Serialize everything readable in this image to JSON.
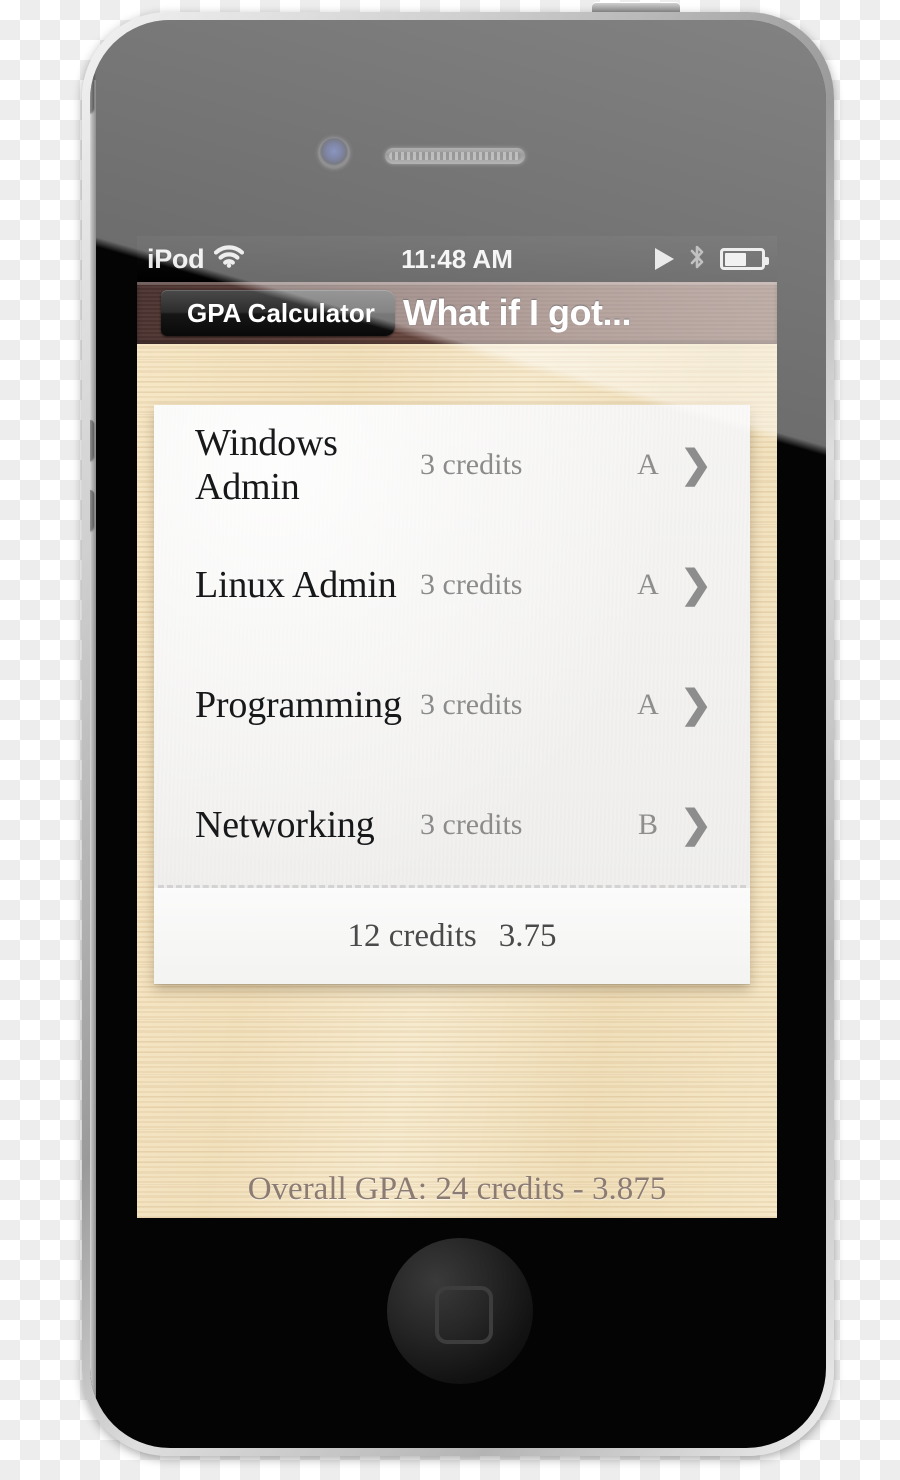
{
  "status_bar": {
    "carrier": "iPod",
    "wifi_icon": "wifi-icon",
    "time": "11:48 AM",
    "play_icon": "play-icon",
    "bluetooth_icon": "bluetooth-icon",
    "battery_icon": "battery-icon",
    "battery_level_percent": 60
  },
  "nav_bar": {
    "back_label": "GPA Calculator",
    "title": "What if I got..."
  },
  "course_list": {
    "rows": [
      {
        "name": "Windows Admin",
        "credits": "3 credits",
        "grade": "A",
        "chevron": "chevron-right-icon"
      },
      {
        "name": "Linux Admin",
        "credits": "3 credits",
        "grade": "A",
        "chevron": "chevron-right-icon"
      },
      {
        "name": "Programming",
        "credits": "3 credits",
        "grade": "A",
        "chevron": "chevron-right-icon"
      },
      {
        "name": "Networking",
        "credits": "3 credits",
        "grade": "B",
        "chevron": "chevron-right-icon"
      }
    ],
    "summary": {
      "credits": "12 credits",
      "gpa": "3.75"
    }
  },
  "overall": {
    "text": "Overall GPA: 24 credits - 3.875"
  },
  "colors": {
    "wood_background": "#f3e2bf",
    "nav_bar_wood": "#6d4a42",
    "paper": "#f4f3f1",
    "course_name_text": "#17181a",
    "muted_text": "#8b8b8b",
    "overall_text": "#8c7b72",
    "status_bar": "#000000"
  },
  "device": {
    "camera_icon": "front-camera-icon",
    "speaker_icon": "earpiece-speaker-icon",
    "home_button_icon": "home-button-icon",
    "sleep_button_icon": "sleep-wake-button-icon",
    "mute_switch_icon": "mute-switch-icon",
    "volume_up_icon": "volume-up-button-icon",
    "volume_down_icon": "volume-down-button-icon"
  }
}
